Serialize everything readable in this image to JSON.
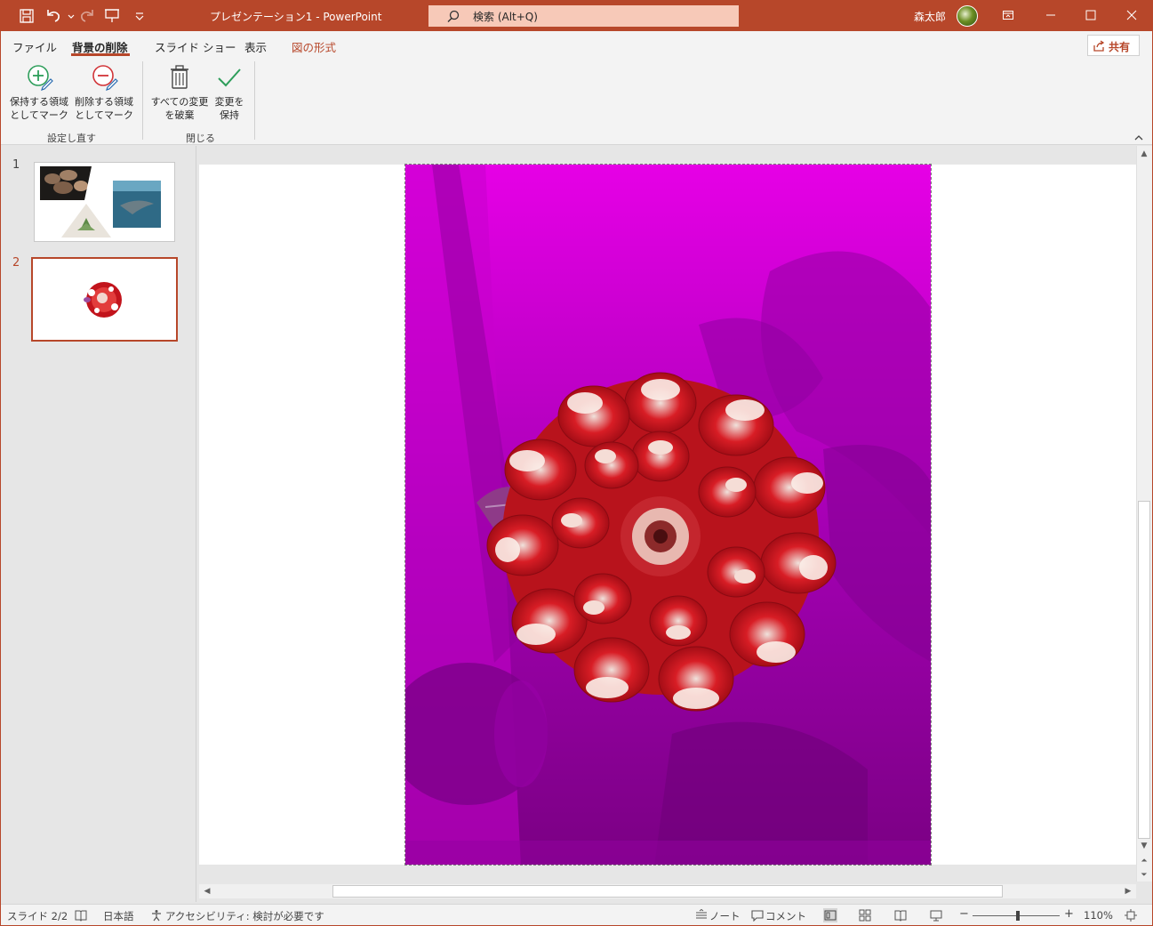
{
  "app": {
    "doc_title": "プレゼンテーション1  -  PowerPoint",
    "search_text": "検索 (Alt+Q)",
    "user_name": "森太郎",
    "accent_color": "#b7472a"
  },
  "quick_access": {
    "save_icon": "save-icon",
    "undo_icon": "undo-icon",
    "redo_icon": "redo-icon",
    "present_icon": "present-from-beginning-icon",
    "customize_icon": "customize-qat-icon"
  },
  "tabs": [
    {
      "label": "ファイル",
      "active": false
    },
    {
      "label": "背景の削除",
      "active": true
    },
    {
      "label": "スライド ショー",
      "active": false
    },
    {
      "label": "表示",
      "active": false
    },
    {
      "label": "図の形式",
      "active": false,
      "contextual": true
    }
  ],
  "share_label": "共有",
  "ribbon": {
    "groups": [
      {
        "label": "設定し直す",
        "buttons": [
          {
            "line1": "保持する領域",
            "line2": "としてマーク",
            "icon": "mark-areas-to-keep-icon"
          },
          {
            "line1": "削除する領域",
            "line2": "としてマーク",
            "icon": "mark-areas-to-remove-icon"
          }
        ]
      },
      {
        "label": "閉じる",
        "buttons": [
          {
            "line1": "すべての変更",
            "line2": "を破棄",
            "icon": "discard-all-changes-icon"
          },
          {
            "line1": "変更を",
            "line2": "保持",
            "icon": "keep-changes-icon"
          }
        ]
      }
    ]
  },
  "slides": [
    {
      "number": "1",
      "selected": false
    },
    {
      "number": "2",
      "selected": true
    }
  ],
  "status": {
    "slide_indicator": "スライド 2/2",
    "language": "日本語",
    "accessibility": "アクセシビリティ: 検討が必要です",
    "notes_label": "ノート",
    "comments_label": "コメント",
    "zoom_level": "110%",
    "zoom_fraction": 0.52
  }
}
